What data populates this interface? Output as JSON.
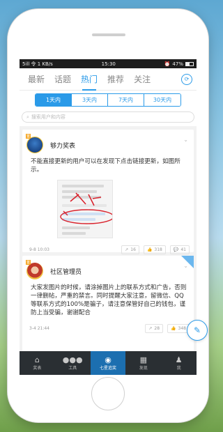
{
  "status": {
    "left": "5ill 令 1 KB/s",
    "time": "15:30",
    "battery": "47%",
    "battery_level": 0.47
  },
  "topnav": {
    "tabs": [
      {
        "label": "最新",
        "active": false
      },
      {
        "label": "话题",
        "active": false
      },
      {
        "label": "热门",
        "active": true
      },
      {
        "label": "推荐",
        "active": false
      },
      {
        "label": "关注",
        "active": false
      }
    ],
    "refresh_icon": "refresh-icon"
  },
  "time_filter": {
    "options": [
      "1天内",
      "3天内",
      "7天内",
      "30天内"
    ],
    "selected": "1天内"
  },
  "search": {
    "placeholder": "搜索用户和内容"
  },
  "posts": [
    {
      "author": "够力奖表",
      "text": "不能直接更新的用户可以在发现下点击链接更新，如图所示。",
      "time": "9-8 10:03",
      "shares": "16",
      "likes": "318",
      "comments": "41"
    },
    {
      "author": "社区管理员",
      "text": "大家发图片的时候，请涂掉图片上的联系方式和广告，否则一律删帖，严重的禁言。同时提醒大家注意，留微信、QQ等联系方式的100%是骗子，请注意保管好自己的钱包，谨防上当受骗，谢谢配合",
      "time": "3-4 21:44",
      "shares": "28",
      "likes": "348"
    }
  ],
  "tabbar": [
    {
      "label": "奖表",
      "icon": "home-icon"
    },
    {
      "label": "工具",
      "icon": "tools-icon"
    },
    {
      "label": "七星追奖",
      "icon": "lottery-icon"
    },
    {
      "label": "发现",
      "icon": "discover-icon"
    },
    {
      "label": "我",
      "icon": "user-icon"
    }
  ],
  "colors": {
    "accent": "#2a9ae8",
    "tabbar": "#2a2f33",
    "tabbar_active": "#1c6fb0",
    "badge": "#f5a623"
  }
}
